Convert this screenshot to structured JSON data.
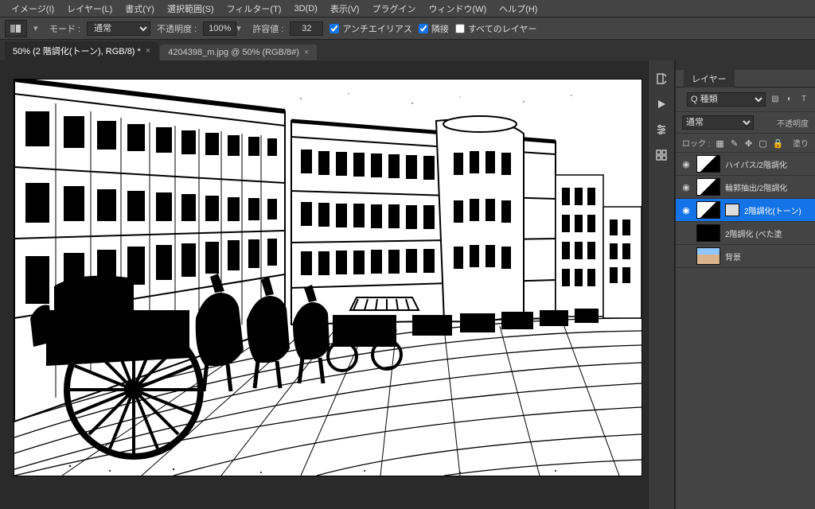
{
  "menu": [
    "イメージ(I)",
    "レイヤー(L)",
    "書式(Y)",
    "選択範囲(S)",
    "フィルター(T)",
    "3D(D)",
    "表示(V)",
    "プラグイン",
    "ウィンドウ(W)",
    "ヘルプ(H)"
  ],
  "optbar": {
    "mode_label": "モード :",
    "mode_value": "通常",
    "opacity_label": "不透明度 :",
    "opacity_value": "100%",
    "tolerance_label": "許容値 :",
    "tolerance_value": "32",
    "antialias": "アンチエイリアス",
    "contiguous": "隣接",
    "alllayers": "すべてのレイヤー",
    "antialias_checked": true,
    "contiguous_checked": true,
    "alllayers_checked": false
  },
  "tabs": [
    {
      "label": "50% (2 階調化(トーン), RGB/8) *",
      "active": true
    },
    {
      "label": "4204398_m.jpg @ 50% (RGB/8#)",
      "active": false
    }
  ],
  "panel": {
    "title": "レイヤー",
    "filter_kind": "Q 種類",
    "blend": "通常",
    "opacity_lbl": "不透明度",
    "lock_label": "ロック :",
    "fill_label": "塗り"
  },
  "layers": [
    {
      "visible": true,
      "name": "ハイパス/2階調化",
      "kind": "img"
    },
    {
      "visible": true,
      "name": "輪郭抽出/2階調化",
      "kind": "img"
    },
    {
      "visible": true,
      "name": "2階調化(トーン)",
      "kind": "img",
      "selected": true,
      "hasMask": true,
      "hasMini": true
    },
    {
      "visible": false,
      "name": "2階調化 (べた塗",
      "kind": "img",
      "hasMask": true
    },
    {
      "visible": false,
      "name": "背景",
      "kind": "color"
    }
  ]
}
